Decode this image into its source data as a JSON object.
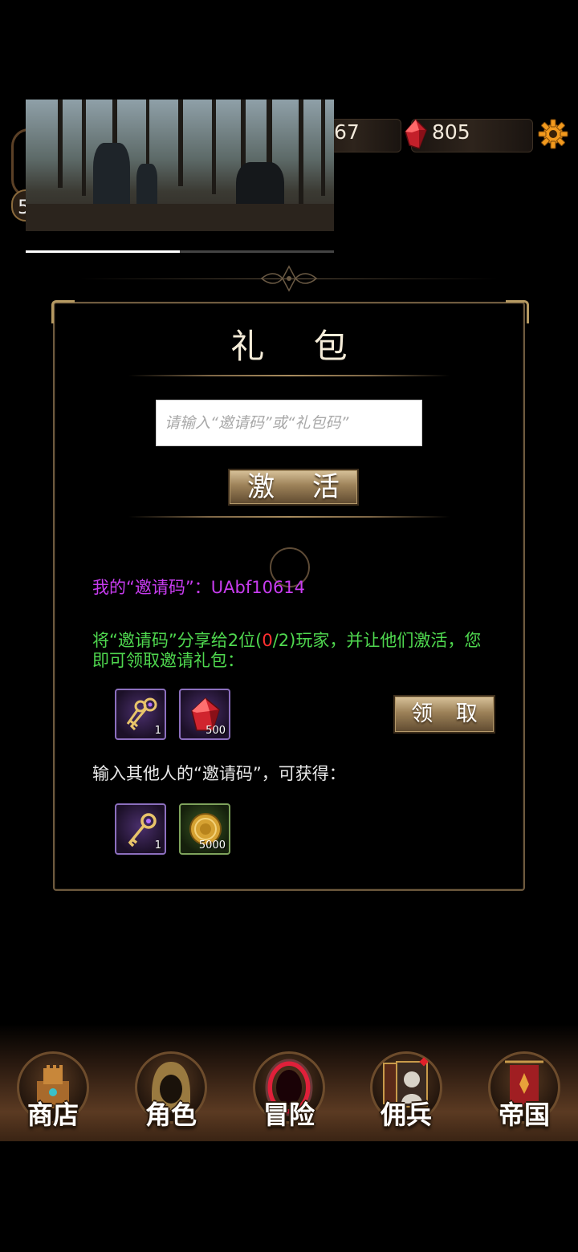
{
  "hud": {
    "level": "5",
    "resource_value": "67",
    "gem_count": "805"
  },
  "video": {
    "progress": 0.5
  },
  "dialog": {
    "title": "礼 包",
    "code_input_placeholder": "请输入“邀请码”或“礼包码”",
    "code_input_value": "",
    "activate_label": "激 活",
    "invite_code_label": "我的“邀请码”：",
    "invite_code": "UAbf10614",
    "share_text_prefix": "将“邀请码”分享给2位(",
    "share_progress_current": "0",
    "share_progress_rest": "/2)玩家，并让他们激活，您即可领取邀请礼包：",
    "invite_rewards": [
      {
        "icon": "keys-icon",
        "qty": "1"
      },
      {
        "icon": "red-gem-icon",
        "qty": "500"
      }
    ],
    "claim_label": "领 取",
    "other_code_text": "输入其他人的“邀请码”，可获得：",
    "other_rewards": [
      {
        "icon": "key-icon",
        "qty": "1"
      },
      {
        "icon": "gold-coin-icon",
        "qty": "5000"
      }
    ]
  },
  "nav": {
    "items": [
      {
        "label": "商店",
        "icon": "castle-icon"
      },
      {
        "label": "角色",
        "icon": "hooded-figure-icon"
      },
      {
        "label": "冒险",
        "icon": "portal-icon"
      },
      {
        "label": "佣兵",
        "icon": "mercenary-card-icon"
      },
      {
        "label": "帝国",
        "icon": "banner-icon"
      }
    ]
  },
  "colors": {
    "invite_purple": "#c83cf0",
    "share_green": "#4fd84f",
    "progress_red": "#ff3030",
    "gold_frame": "#b69a62"
  }
}
